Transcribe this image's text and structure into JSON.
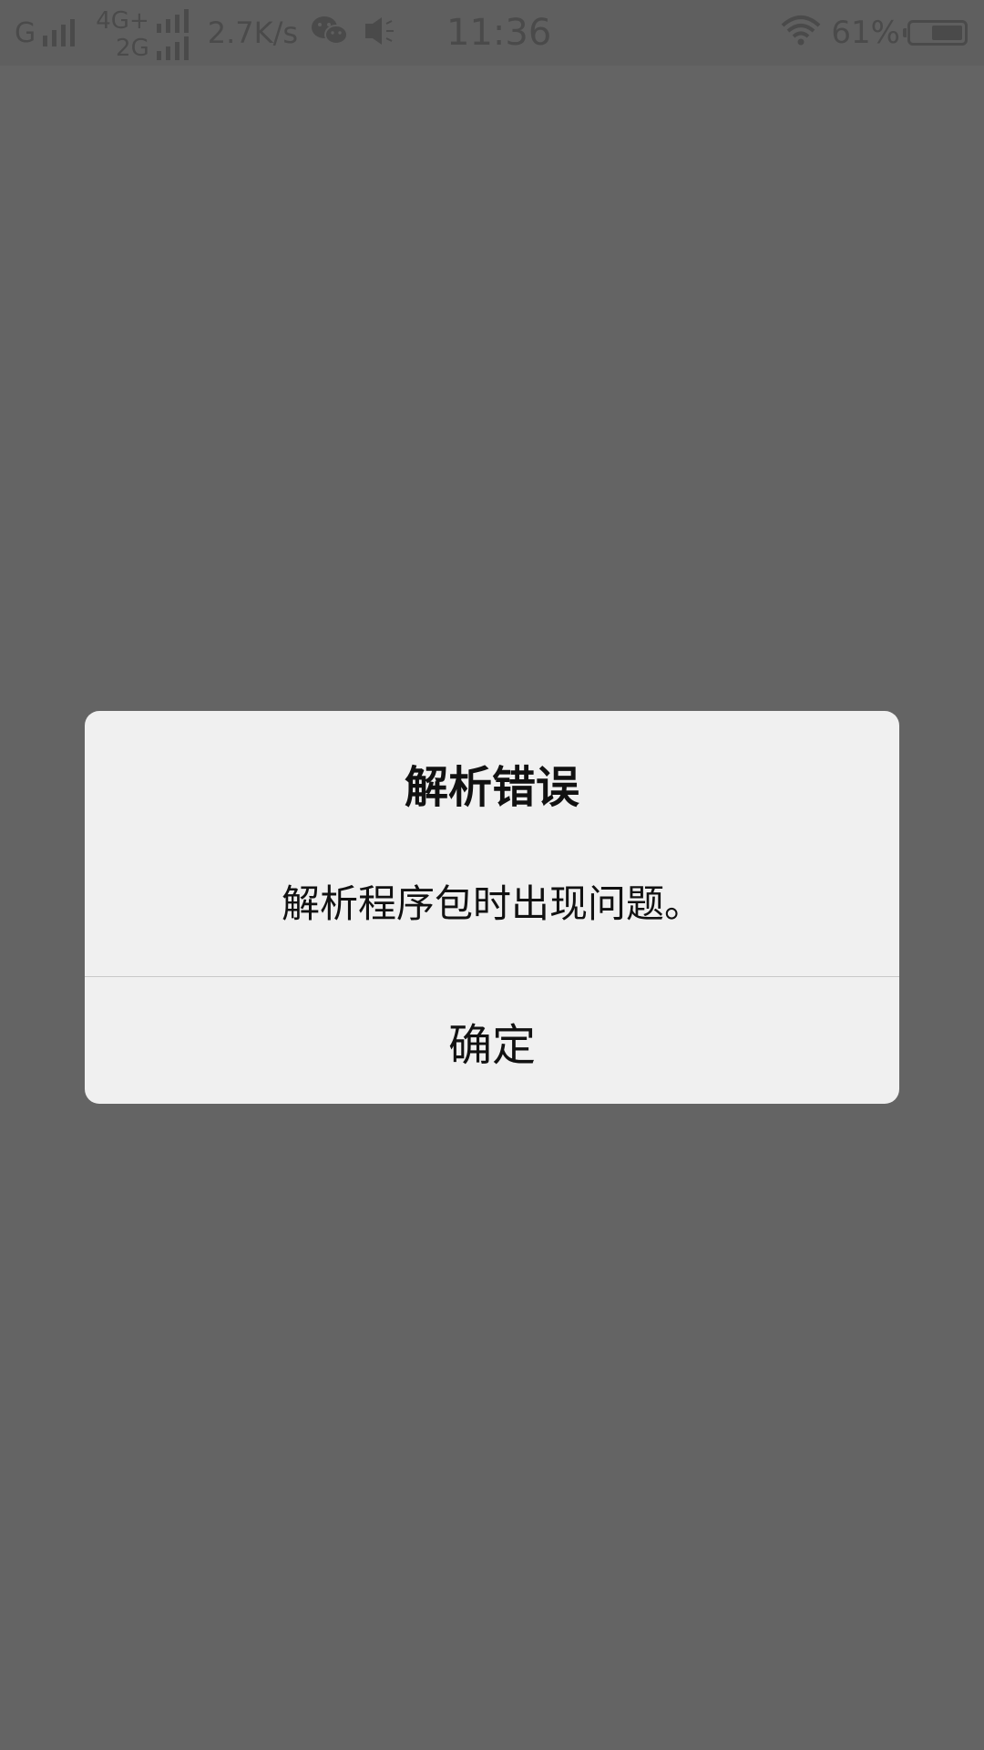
{
  "status_bar": {
    "carrier1": "G",
    "net_top": "4G+",
    "net_bottom": "2G",
    "speed": "2.7K/s",
    "time": "11:36",
    "battery_pct": "61%",
    "battery_level": 0.61,
    "icons": [
      "signal-icon",
      "wechat-icon",
      "vibrate-icon",
      "wifi-icon",
      "battery-icon"
    ]
  },
  "dialog": {
    "title": "解析错误",
    "message": "解析程序包时出现问题。",
    "ok_label": "确定"
  },
  "colors": {
    "overlay": "#646464",
    "dialog_bg": "#f0f0f0",
    "text": "#111111"
  }
}
